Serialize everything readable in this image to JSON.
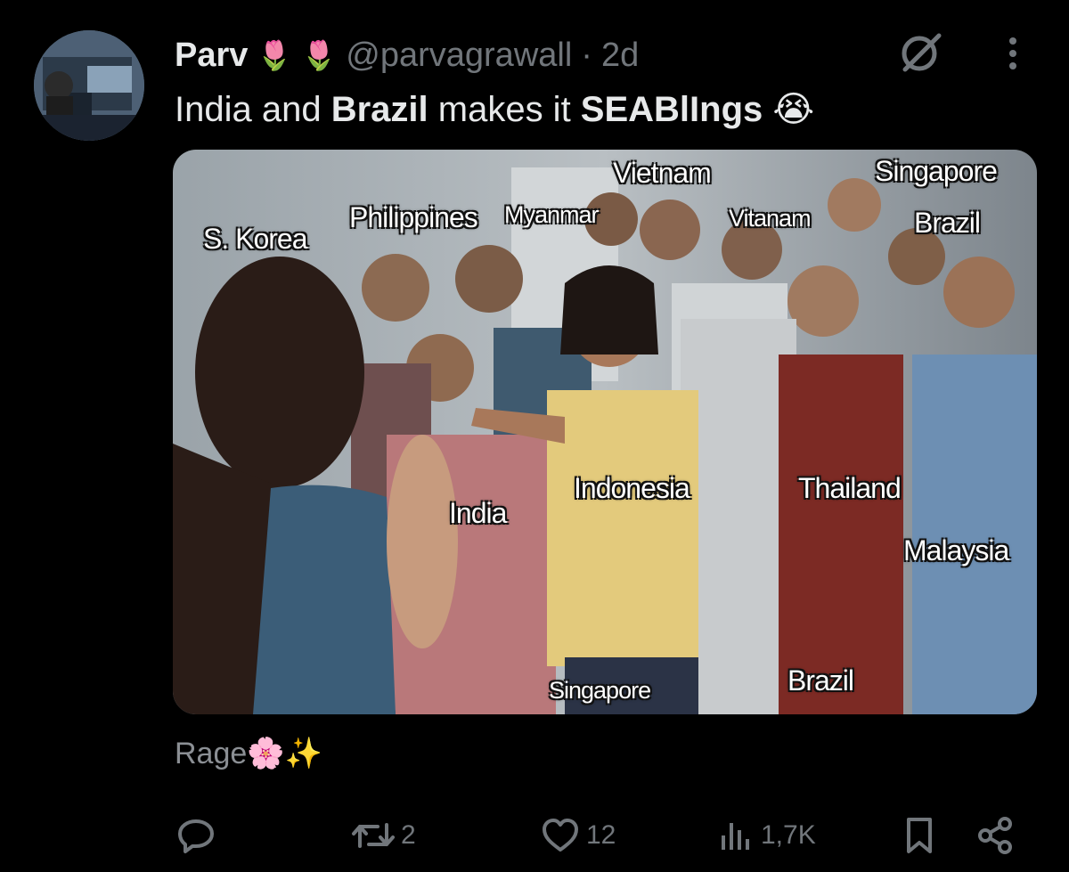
{
  "tweet": {
    "author_name": "Parv",
    "name_emojis": "🌷 🌷",
    "handle": "@parvagrawall",
    "separator": "·",
    "time": "2d",
    "text_parts": [
      "India and ",
      "Brazil",
      " makes it ",
      "SEABlIngs",
      " 😭"
    ]
  },
  "media": {
    "labels": {
      "s_korea": "S. Korea",
      "philippines": "Philippines",
      "myanmar": "Myanmar",
      "vietnam": "Vietnam",
      "vitanam": "Vitanam",
      "singapore_top": "Singapore",
      "brazil_top": "Brazil",
      "india": "India",
      "indonesia": "Indonesia",
      "thailand": "Thailand",
      "malaysia": "Malaysia",
      "singapore_bottom": "Singapore",
      "brazil_bottom": "Brazil"
    }
  },
  "caption": {
    "text": "Rage",
    "emojis": "🌸✨"
  },
  "actions": {
    "reply_count": "",
    "retweet_count": "2",
    "like_count": "12",
    "views_count": "1,7K"
  },
  "icons": {
    "grok": "grok-icon",
    "more": "more-vertical-icon",
    "reply": "reply-icon",
    "retweet": "retweet-icon",
    "like": "heart-icon",
    "views": "views-icon",
    "bookmark": "bookmark-icon",
    "share": "share-icon"
  },
  "colors": {
    "background": "#000000",
    "text_primary": "#e7e9ea",
    "text_secondary": "#71767b"
  }
}
